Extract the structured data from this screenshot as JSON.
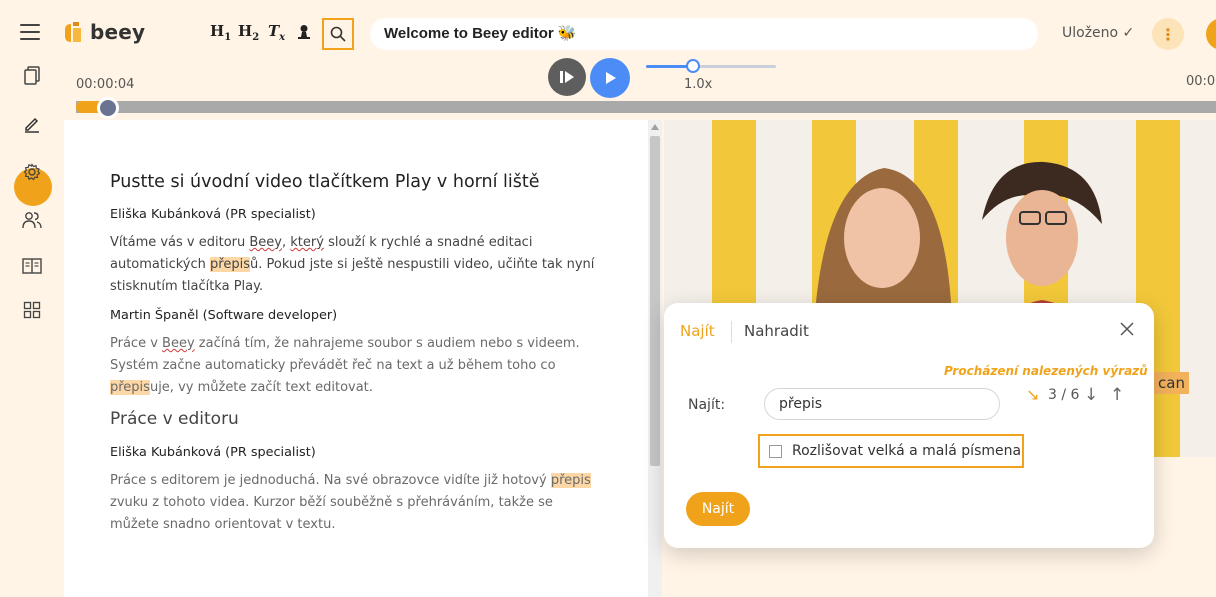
{
  "header": {
    "logo_text": "beey",
    "format_buttons": [
      {
        "name": "heading-1-button",
        "main": "H",
        "sub": "1"
      },
      {
        "name": "heading-2-button",
        "main": "H",
        "sub": "2"
      },
      {
        "name": "clear-format-button",
        "main": "T",
        "sub": "x"
      }
    ],
    "document_title": "Welcome to Beey editor 🐝",
    "save_status": "Uloženo ✓",
    "more_label": "⋮"
  },
  "player": {
    "current_time": "00:00:04",
    "total_time": "00:0",
    "speed_label": "1.0x",
    "speed_fraction": 0.35,
    "progress_fraction": 0.028
  },
  "editor": {
    "heading_1": "Pustte si úvodní video tlačítkem Play v horní liště",
    "block_1": {
      "speaker": "Eliška Kubánková (PR specialist)",
      "t1": "Vítáme vás v editoru ",
      "beey": "Beey",
      "t2": ", ",
      "ktery": "který",
      "t3": " slouží k rychlé a snadné editaci automatických ",
      "hl": "přepis",
      "t4": "ů. Pokud jste si ještě nespustili video, učiňte tak nyní stisknutím tlačítka Play."
    },
    "block_2": {
      "speaker": "Martin Španěl (Software developer)",
      "t1": "Práce v ",
      "beey": "Beey",
      "t2": " začíná tím, že nahrajeme soubor s audiem nebo s videem. Systém začne automaticky převádět řeč na text a už během toho co ",
      "hl": "přepis",
      "t3": "uje, vy můžete začít text editovat."
    },
    "heading_2": "Práce v editoru",
    "block_3": {
      "speaker": "Eliška Kubánková (PR specialist)",
      "t1": "Práce s editorem je jednoduchá. Na své obrazovce vidíte již hotový ",
      "hl": "přepis",
      "t2": " zvuku z tohoto videa. Kurzor běží souběžně s přehráváním, takže se můžete snadno orientovat v textu."
    }
  },
  "video": {
    "caption_fragment": "can"
  },
  "find_dialog": {
    "tab_find": "Najít",
    "tab_replace": "Nahradit",
    "hint": "Procházení nalezených výrazů",
    "counter": "3 / 6",
    "find_label": "Najít:",
    "find_value": "přepis",
    "case_label": "Rozlišovat velká a malá písmena",
    "find_button": "Najít"
  },
  "colors": {
    "accent": "#f0a31a",
    "play_blue": "#4b8cf7",
    "highlight": "#fdd7a6",
    "background": "#fff4e6"
  }
}
